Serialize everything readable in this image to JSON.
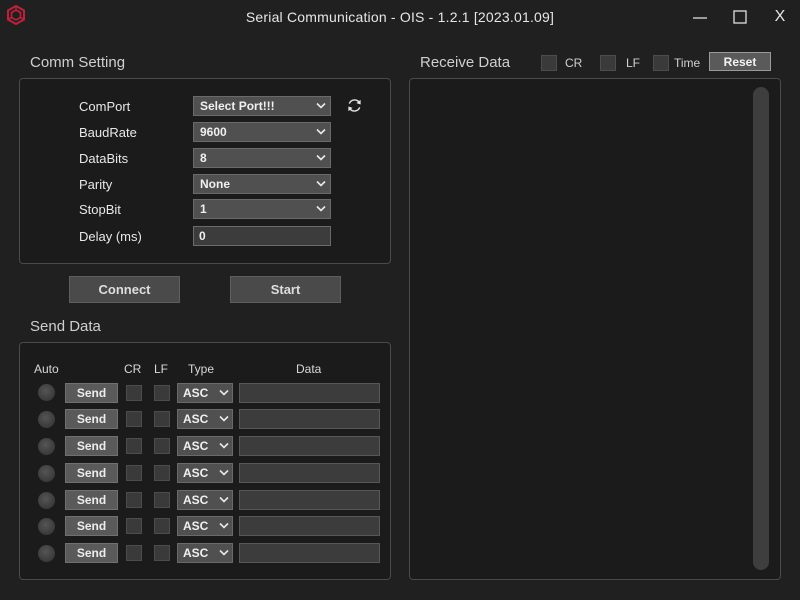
{
  "window": {
    "title": "Serial Communication - OIS - 1.2.1 [2023.01.09]",
    "minimize_icon": "minimize-icon",
    "maximize_icon": "maximize-icon",
    "close_label": "X"
  },
  "comm_setting": {
    "heading": "Comm Setting",
    "refresh_icon": "refresh-icon",
    "fields": [
      {
        "label": "ComPort",
        "value": "Select Port!!!"
      },
      {
        "label": "BaudRate",
        "value": "9600"
      },
      {
        "label": "DataBits",
        "value": "8"
      },
      {
        "label": "Parity",
        "value": "None"
      },
      {
        "label": "StopBit",
        "value": "1"
      },
      {
        "label": "Delay (ms)",
        "value": "0"
      }
    ],
    "connect_label": "Connect",
    "start_label": "Start"
  },
  "send_data": {
    "heading": "Send Data",
    "columns": {
      "auto": "Auto",
      "cr": "CR",
      "lf": "LF",
      "type": "Type",
      "data": "Data"
    },
    "rows": [
      {
        "send_label": "Send",
        "type": "ASC",
        "data": ""
      },
      {
        "send_label": "Send",
        "type": "ASC",
        "data": ""
      },
      {
        "send_label": "Send",
        "type": "ASC",
        "data": ""
      },
      {
        "send_label": "Send",
        "type": "ASC",
        "data": ""
      },
      {
        "send_label": "Send",
        "type": "ASC",
        "data": ""
      },
      {
        "send_label": "Send",
        "type": "ASC",
        "data": ""
      },
      {
        "send_label": "Send",
        "type": "ASC",
        "data": ""
      }
    ]
  },
  "receive_data": {
    "heading": "Receive Data",
    "cr_label": "CR",
    "lf_label": "LF",
    "time_label": "Time",
    "reset_label": "Reset",
    "content": ""
  },
  "colors": {
    "background": "#202020",
    "panel": "#1b1b1b",
    "border": "#4a4a4a",
    "app_icon": "#c0203a"
  }
}
